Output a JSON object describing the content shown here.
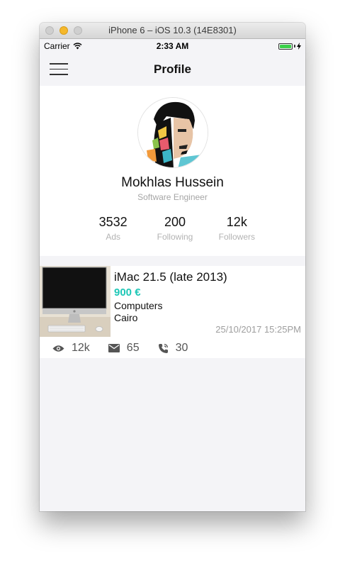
{
  "window": {
    "title": "iPhone 6 – iOS 10.3 (14E8301)"
  },
  "status_bar": {
    "carrier": "Carrier",
    "time": "2:33 AM"
  },
  "nav": {
    "title": "Profile"
  },
  "profile": {
    "name": "Mokhlas Hussein",
    "role": "Software Engineer",
    "stats": [
      {
        "value": "3532",
        "label": "Ads"
      },
      {
        "value": "200",
        "label": "Following"
      },
      {
        "value": "12k",
        "label": "Followers"
      }
    ]
  },
  "ad": {
    "title": "iMac 21.5 (late 2013)",
    "price": "900 €",
    "category": "Computers",
    "city": "Cairo",
    "date": "25/10/2017 15:25PM",
    "views": "12k",
    "messages": "65",
    "calls": "30",
    "price_color": "#1ec7b6"
  },
  "icons": [
    "menu-icon",
    "wifi-icon",
    "battery-icon",
    "eye-icon",
    "mail-icon",
    "phone-icon"
  ]
}
